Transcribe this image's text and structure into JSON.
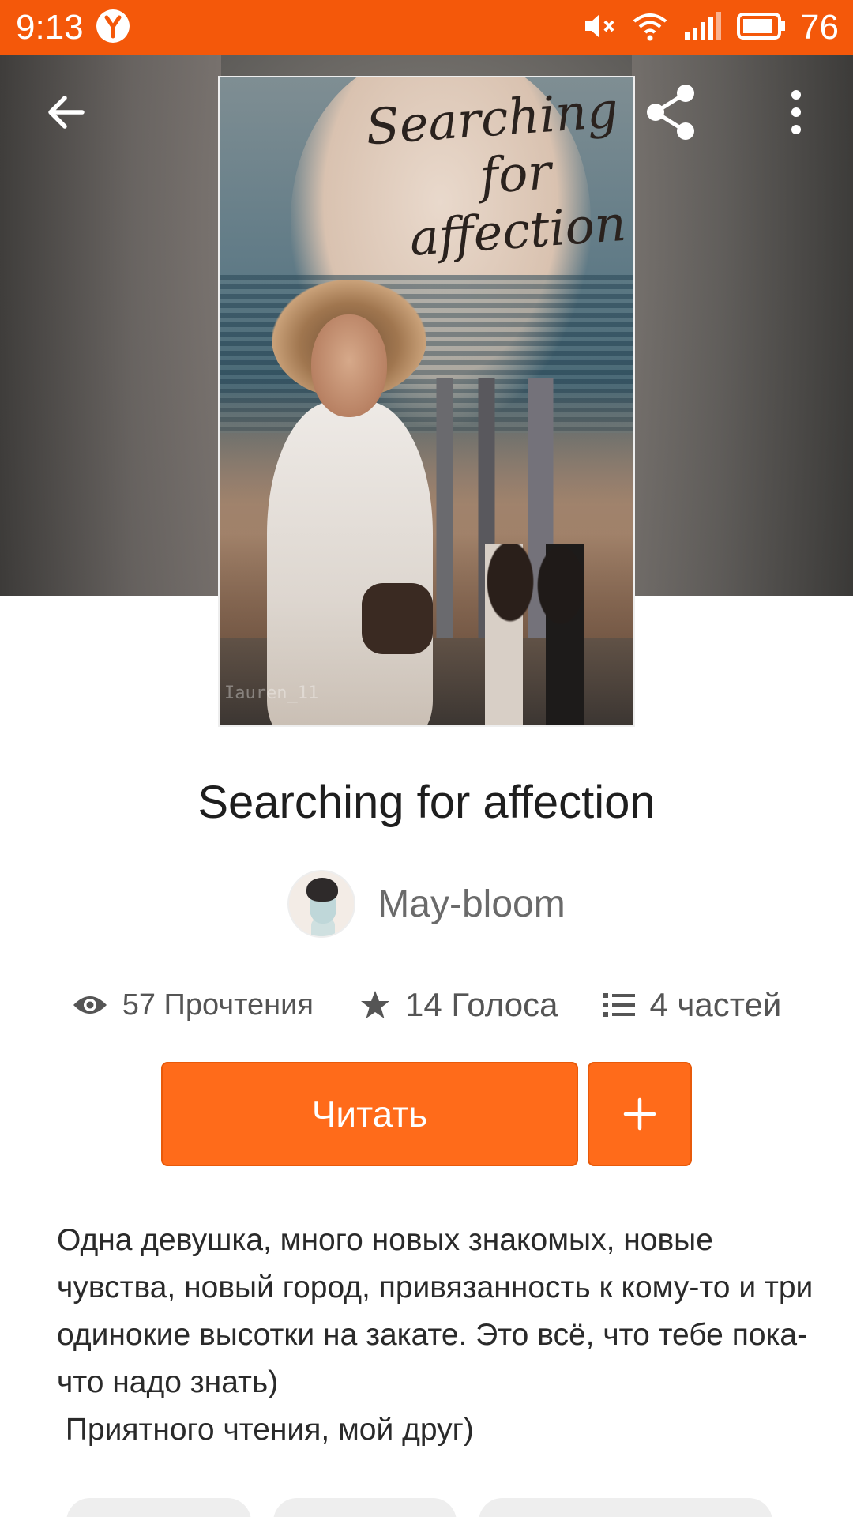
{
  "status_bar": {
    "time": "9:13",
    "battery": "76",
    "bg_color": "#f4580a"
  },
  "toolbar": {
    "back_icon": "arrow-left-icon",
    "share_icon": "share-icon",
    "more_icon": "more-vertical-icon"
  },
  "cover": {
    "title_lines": [
      "Searching",
      "for",
      "affection"
    ],
    "watermark": "Iauren_11"
  },
  "story": {
    "title": "Searching for affection",
    "author": "May-bloom"
  },
  "stats": {
    "reads": "57 Прочтения",
    "votes": "14 Голоса",
    "parts": "4 частей"
  },
  "actions": {
    "read_label": "Читать",
    "add_icon": "plus-icon",
    "accent_color": "#ff6b1a"
  },
  "description": "Одна девушка, много новых знакомых, новые чувства, новый город, привязанность к кому-то и три одинокие высотки на закате. Это всё, что тебе пока-что надо знать)\n Приятного чтения, мой друг)"
}
